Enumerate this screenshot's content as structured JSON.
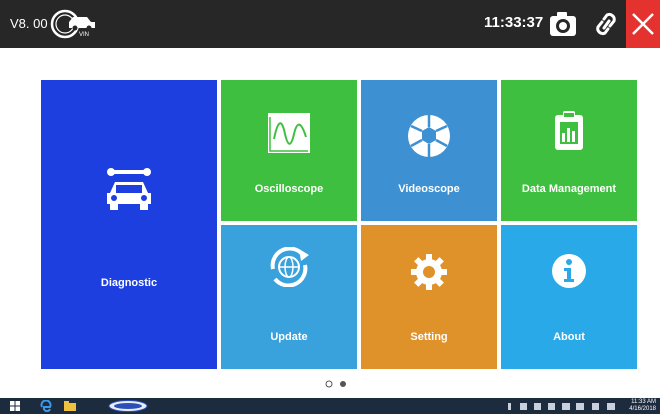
{
  "header": {
    "version": "V8. 00",
    "vin_label": "VIN",
    "clock": "11:33:37"
  },
  "tiles": {
    "diagnostic": "Diagnostic",
    "oscilloscope": "Oscilloscope",
    "videoscope": "Videoscope",
    "data_management": "Data Management",
    "update": "Update",
    "setting": "Setting",
    "about": "About"
  },
  "pager": {
    "current_page": 1,
    "total_pages": 2
  },
  "taskbar": {
    "time": "11:33 AM",
    "date": "4/16/2018"
  },
  "colors": {
    "diagnostic": "#1d3fe0",
    "green": "#3fbf3f",
    "videoscope": "#3d91d2",
    "update": "#39a2dc",
    "setting": "#e0922a",
    "about": "#2aa9e8",
    "close": "#e4322f"
  }
}
